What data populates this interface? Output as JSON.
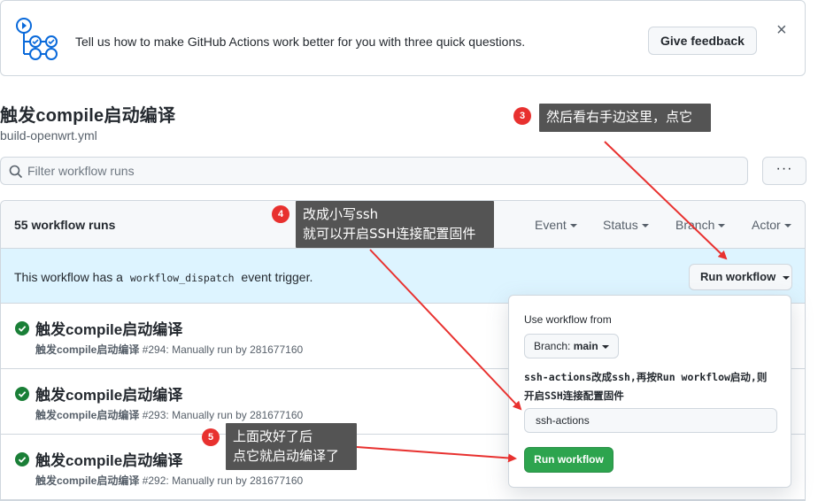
{
  "banner": {
    "message": "Tell us how to make GitHub Actions work better for you with three quick questions.",
    "feedback_label": "Give feedback",
    "close_glyph": "×"
  },
  "page": {
    "title": "触发compile启动编译",
    "subtitle": "build-openwrt.yml"
  },
  "filter": {
    "placeholder": "Filter workflow runs",
    "more_glyph": "···"
  },
  "runs": {
    "count_label": "55 workflow runs",
    "filters": [
      "Event",
      "Status",
      "Branch",
      "Actor"
    ],
    "dispatch_prefix": "This workflow has a",
    "dispatch_code": "workflow_dispatch",
    "dispatch_suffix": "event trigger.",
    "run_workflow_label": "Run workflow",
    "items": [
      {
        "title": "触发compile启动编译",
        "workflow": "触发compile启动编译",
        "detail": "#294: Manually run by 281677160",
        "status": "success"
      },
      {
        "title": "触发compile启动编译",
        "workflow": "触发compile启动编译",
        "detail": "#293: Manually run by 281677160",
        "status": "success"
      },
      {
        "title": "触发compile启动编译",
        "workflow": "触发compile启动编译",
        "detail": "#292: Manually run by 281677160",
        "status": "success"
      }
    ]
  },
  "panel": {
    "use_from_label": "Use workflow from",
    "branch_prefix": "Branch:",
    "branch_value": "main",
    "input_label_line1": "ssh-actions改成ssh,再按Run workflow启动,则",
    "input_label_line2": "开启SSH连接配置固件",
    "input_value": "ssh-actions",
    "run_label": "Run workflow"
  },
  "annotations": [
    {
      "number": "3",
      "lines": [
        "然后看右手边这里，点它"
      ]
    },
    {
      "number": "4",
      "lines": [
        "改成小写ssh",
        "就可以开启SSH连接配置固件"
      ]
    },
    {
      "number": "5",
      "lines": [
        "上面改好了后",
        "点它就启动编译了"
      ]
    }
  ],
  "colors": {
    "accent_blue": "#0969da",
    "success_green": "#1a7f37",
    "button_green": "#2da44e",
    "annotation_red": "#e8312f",
    "note_bg": "#545454",
    "dispatch_bg": "#ddf4ff"
  },
  "icons": [
    "actions-illustration-icon",
    "close-icon",
    "search-icon",
    "check-circle-icon",
    "caret-down-icon"
  ]
}
